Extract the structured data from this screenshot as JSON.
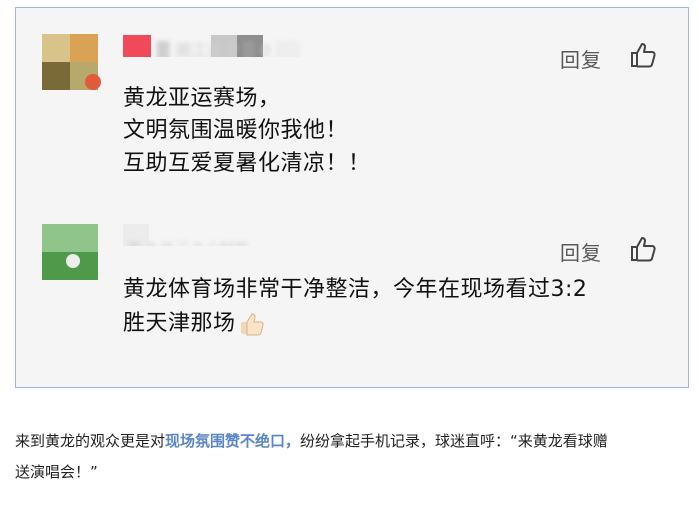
{
  "comments": [
    {
      "reply_label": "回复",
      "lines": [
        "黄龙亚运赛场，",
        "文明氛围温暖你我他！",
        "互助互爱夏暑化清凉！！"
      ]
    },
    {
      "reply_label": "回复",
      "lines": [
        "黄龙体育场非常干净整洁，今年在现场看过3:2",
        "胜天津那场"
      ]
    }
  ],
  "article": {
    "prefix": "来到黄龙的观众更是对",
    "highlight": "现场氛围赞不绝口，",
    "middle": "纷纷拿起手机记录，球迷直呼：“来黄龙看球赠",
    "line2": "送演唱会！”"
  },
  "colors": {
    "border": "#9fb4e1",
    "highlight": "#5b86c5",
    "panel": "#f5f5f5"
  },
  "icons": [
    "thumbs-up-icon",
    "thumbs-up-emoji"
  ]
}
